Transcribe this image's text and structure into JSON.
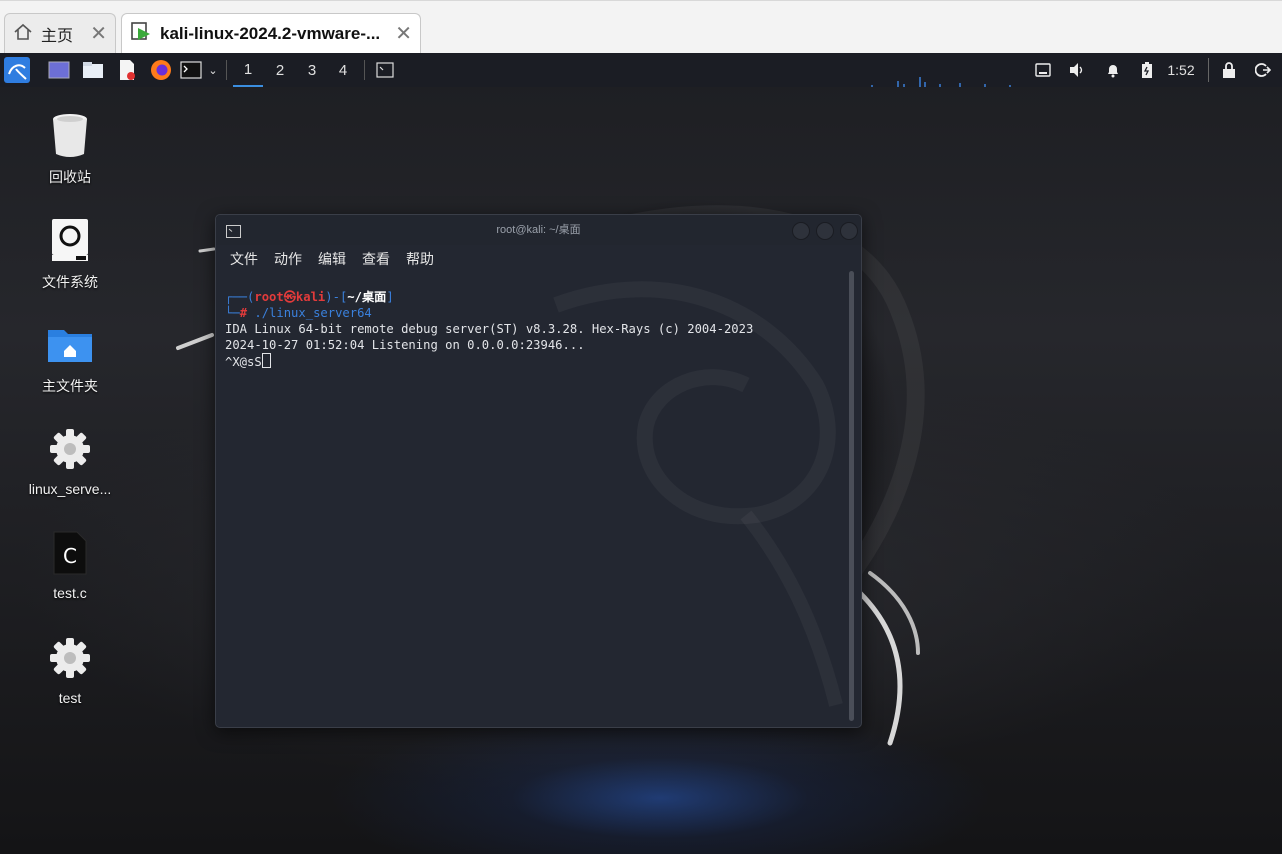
{
  "host": {
    "tabs": [
      {
        "label": "主页",
        "icon": "home-icon"
      },
      {
        "label": "kali-linux-2024.2-vmware-...",
        "icon": "vm-icon"
      }
    ],
    "close_glyph": "✕"
  },
  "taskbar": {
    "workspaces": [
      "1",
      "2",
      "3",
      "4"
    ],
    "active_workspace": "1",
    "clock": "1:52",
    "tray_icons": [
      "network-icon",
      "volume-icon",
      "notification-bell-icon",
      "battery-icon",
      "lock-icon",
      "logout-icon"
    ]
  },
  "desktop": {
    "icons": [
      {
        "label": "回收站",
        "icon": "trash-icon"
      },
      {
        "label": "文件系统",
        "icon": "drive-icon"
      },
      {
        "label": "主文件夹",
        "icon": "home-folder-icon"
      },
      {
        "label": "linux_serve...",
        "icon": "gear-icon"
      },
      {
        "label": "test.c",
        "icon": "c-file-icon"
      },
      {
        "label": "test",
        "icon": "gear-icon"
      }
    ]
  },
  "terminal": {
    "title": "root@kali: ~/桌面",
    "menu": [
      "文件",
      "动作",
      "编辑",
      "查看",
      "帮助"
    ],
    "prompt": {
      "user": "root",
      "at": "㉿",
      "host": "kali",
      "cwd": "~/桌面",
      "symbol": "#",
      "command": "./linux_server64"
    },
    "output": [
      "IDA Linux 64-bit remote debug server(ST) v8.3.28. Hex-Rays (c) 2004-2023",
      "2024-10-27 01:52:04 Listening on 0.0.0.0:23946...",
      "^X@sS"
    ]
  },
  "colors": {
    "taskbar_bg": "#1b1d24",
    "terminal_bg": "#232731",
    "prompt_blue": "#3a80dc",
    "prompt_red": "#e23b3b",
    "workspace_accent": "#3b8ee0"
  }
}
